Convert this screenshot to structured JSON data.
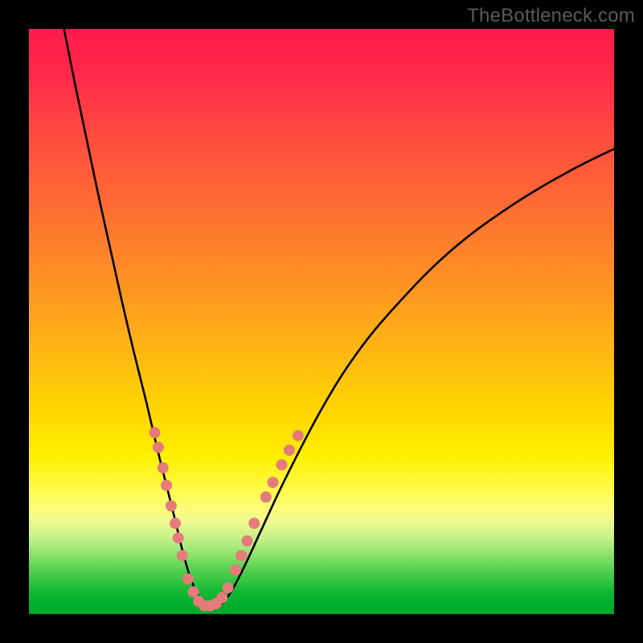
{
  "watermark": "TheBottleneck.com",
  "chart_data": {
    "type": "line",
    "title": "",
    "xlabel": "",
    "ylabel": "",
    "xlim": [
      0,
      100
    ],
    "ylim": [
      0,
      100
    ],
    "grid": false,
    "legend": false,
    "series": [
      {
        "name": "curve",
        "x": [
          6,
          8,
          10,
          12,
          14,
          16,
          18,
          20,
          22,
          23.5,
          25,
          26.2,
          27.5,
          29,
          30.5,
          32,
          34,
          36.5,
          40,
          44,
          50,
          56,
          63,
          72,
          82,
          92,
          100
        ],
        "y": [
          100,
          90,
          80.5,
          71,
          62,
          53,
          44.5,
          36.5,
          28,
          22,
          16,
          11,
          6.5,
          3,
          1.2,
          1.2,
          3,
          7.5,
          15,
          23.5,
          35,
          44.5,
          53,
          62,
          69.5,
          75.5,
          79.5
        ]
      }
    ],
    "beads": {
      "_comment": "clusters of pink bead markers on the curve near the valley",
      "left_branch": [
        {
          "x": 21.5,
          "y": 31
        },
        {
          "x": 22.1,
          "y": 28.5
        },
        {
          "x": 22.9,
          "y": 25
        },
        {
          "x": 23.5,
          "y": 22
        },
        {
          "x": 24.3,
          "y": 18.5
        },
        {
          "x": 25.0,
          "y": 15.5
        },
        {
          "x": 25.5,
          "y": 13
        },
        {
          "x": 26.2,
          "y": 10
        }
      ],
      "bottom": [
        {
          "x": 27.2,
          "y": 6
        },
        {
          "x": 28.1,
          "y": 3.8
        },
        {
          "x": 29.0,
          "y": 2.2
        },
        {
          "x": 30.0,
          "y": 1.4
        },
        {
          "x": 31.0,
          "y": 1.4
        },
        {
          "x": 32.0,
          "y": 1.8
        },
        {
          "x": 33.0,
          "y": 2.8
        },
        {
          "x": 34.0,
          "y": 4.5
        }
      ],
      "right_branch": [
        {
          "x": 35.3,
          "y": 7.5
        },
        {
          "x": 36.3,
          "y": 10
        },
        {
          "x": 37.3,
          "y": 12.5
        },
        {
          "x": 38.5,
          "y": 15.5
        },
        {
          "x": 40.5,
          "y": 20
        },
        {
          "x": 41.7,
          "y": 22.5
        },
        {
          "x": 43.2,
          "y": 25.5
        },
        {
          "x": 44.5,
          "y": 28
        },
        {
          "x": 46.0,
          "y": 30.5
        }
      ]
    },
    "bead_radius": 7
  }
}
